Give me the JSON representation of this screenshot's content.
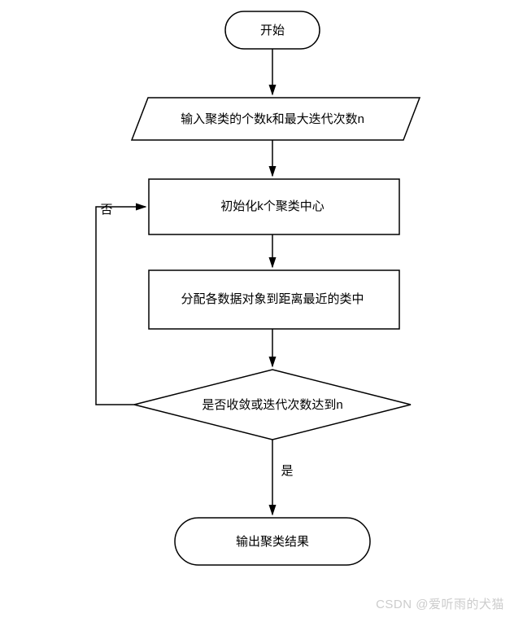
{
  "nodes": {
    "start": "开始",
    "input": "输入聚类的个数k和最大迭代次数n",
    "init": "初始化k个聚类中心",
    "assign": "分配各数据对象到距离最近的类中",
    "decision": "是否收敛或迭代次数达到n",
    "output": "输出聚类结果"
  },
  "edges": {
    "no": "否",
    "yes": "是"
  },
  "watermark": "CSDN @爱听雨的犬猫"
}
